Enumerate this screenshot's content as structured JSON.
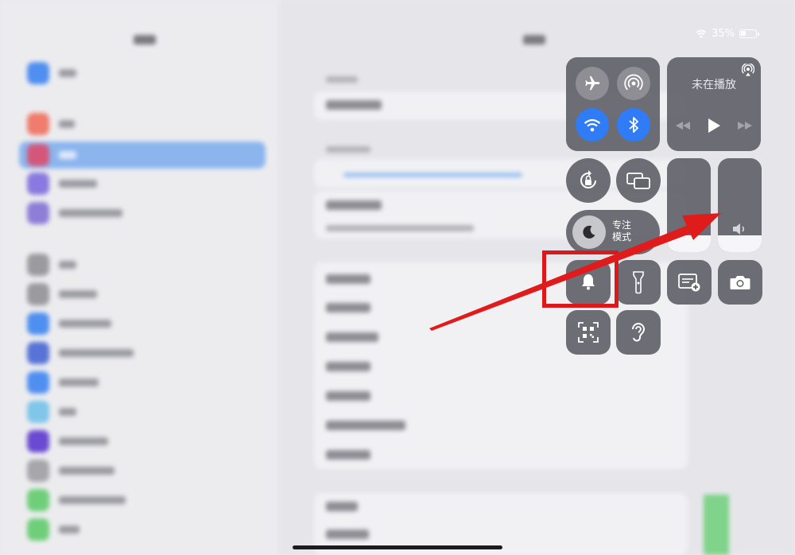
{
  "status_bar": {
    "battery_percent": "35%",
    "wifi_icon": "wifi-icon",
    "battery_icon": "battery-icon"
  },
  "control_center": {
    "connectivity": {
      "airplane_icon": "airplane-icon",
      "airdrop_icon": "airdrop-icon",
      "wifi_icon": "wifi-icon",
      "bluetooth_icon": "bluetooth-icon",
      "wifi_on": true,
      "bluetooth_on": true
    },
    "now_playing": {
      "title": "未在播放",
      "airplay_icon": "airplay-icon",
      "rewind_icon": "rewind-icon",
      "play_icon": "play-icon",
      "forward_icon": "fast-forward-icon"
    },
    "rotation_lock_icon": "rotation-lock-icon",
    "screen_mirroring_icon": "screen-mirroring-icon",
    "focus": {
      "label_line1": "专注",
      "label_line2": "模式",
      "icon": "moon-icon"
    },
    "brightness_level": 0.18,
    "volume_level": 0.18,
    "volume_icon": "speaker-icon",
    "bell_icon": "bell-icon",
    "flashlight_icon": "flashlight-icon",
    "quick_note_icon": "quick-note-icon",
    "camera_icon": "camera-icon",
    "qr_scanner_icon": "qr-code-icon",
    "hearing_icon": "ear-icon"
  },
  "annotation": {
    "highlight_color": "#d9191c",
    "arrow_color": "#e01b1b"
  }
}
